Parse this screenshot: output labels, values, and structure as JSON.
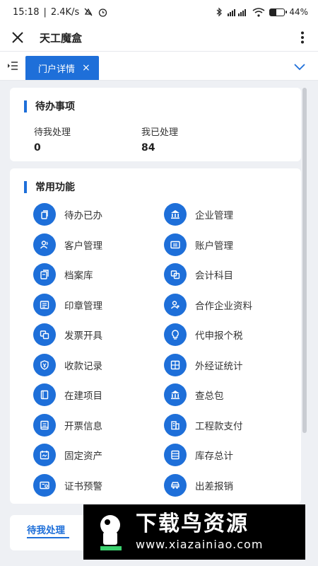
{
  "status_bar": {
    "time": "15:18",
    "speed": "2.4K/s",
    "battery": "44",
    "battery_suffix": "%",
    "battery_level": 0.44
  },
  "header": {
    "title": "天工魔盒"
  },
  "tabs": {
    "active_label": "门户详情",
    "close_glyph": "×"
  },
  "todo": {
    "title": "待办事项",
    "items": [
      {
        "label": "待我处理",
        "count": "0"
      },
      {
        "label": "我已处理",
        "count": "84"
      }
    ]
  },
  "functions": {
    "title": "常用功能",
    "items": [
      {
        "label": "待办已办",
        "icon": "doc-copy-icon"
      },
      {
        "label": "企业管理",
        "icon": "bank-icon"
      },
      {
        "label": "客户管理",
        "icon": "users-icon"
      },
      {
        "label": "账户管理",
        "icon": "account-card-icon"
      },
      {
        "label": "档案库",
        "icon": "archive-icon"
      },
      {
        "label": "会计科目",
        "icon": "ledger-icon"
      },
      {
        "label": "印章管理",
        "icon": "stamp-icon"
      },
      {
        "label": "合作企业资料",
        "icon": "partner-icon"
      },
      {
        "label": "发票开具",
        "icon": "invoice-icon"
      },
      {
        "label": "代申报个税",
        "icon": "bulb-icon"
      },
      {
        "label": "收款记录",
        "icon": "shield-yen-icon"
      },
      {
        "label": "外经证统计",
        "icon": "grid-stat-icon"
      },
      {
        "label": "在建项目",
        "icon": "notebook-icon"
      },
      {
        "label": "查总包",
        "icon": "bank-icon"
      },
      {
        "label": "开票信息",
        "icon": "receipt-icon"
      },
      {
        "label": "工程款支付",
        "icon": "building-pay-icon"
      },
      {
        "label": "固定资产",
        "icon": "calendar-asset-icon"
      },
      {
        "label": "库存总计",
        "icon": "inventory-icon"
      },
      {
        "label": "证书预警",
        "icon": "certificate-icon"
      },
      {
        "label": "出差报销",
        "icon": "car-icon"
      }
    ]
  },
  "bottom": {
    "tab_label": "待我处理"
  },
  "watermark": {
    "title": "下载鸟资源",
    "url": "www.xiazainiao.com"
  },
  "colors": {
    "accent": "#1e6fd9",
    "background": "#eef0f4"
  }
}
